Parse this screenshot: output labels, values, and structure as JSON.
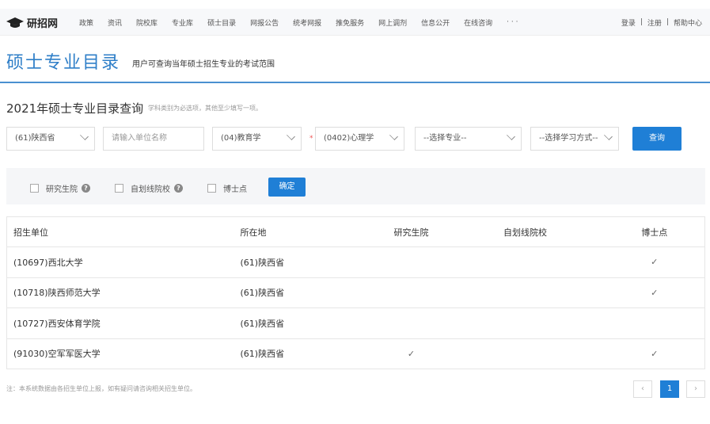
{
  "nav": {
    "logo": "研招网",
    "items": [
      "政策",
      "资讯",
      "院校库",
      "专业库",
      "硕士目录",
      "网报公告",
      "统考网报",
      "推免服务",
      "网上调剂",
      "信息公开",
      "在线咨询",
      "· · ·"
    ],
    "login": "登录",
    "sep": "|",
    "register": "注册",
    "help": "帮助中心"
  },
  "header": {
    "title": "硕士专业目录",
    "subtitle": "用户可查询当年硕士招生专业的考试范围"
  },
  "query": {
    "title": "2021年硕士专业目录查询",
    "hint": "学科类别为必选项，其他至少填写一项。",
    "province": "(61)陕西省",
    "unit_placeholder": "请输入单位名称",
    "category": "(04)教育学",
    "required_mark": "*",
    "discipline": "(0402)心理学",
    "major": "--选择专业--",
    "study_mode": "--选择学习方式--",
    "search": "查询"
  },
  "filters": {
    "graduate_school": "研究生院",
    "self_line": "自划线院校",
    "help_icon": "?",
    "doctoral": "博士点",
    "confirm": "确定"
  },
  "table": {
    "headers": [
      "招生单位",
      "所在地",
      "研究生院",
      "自划线院校",
      "博士点"
    ],
    "rows": [
      {
        "unit": "(10697)西北大学",
        "location": "(61)陕西省",
        "graduate_school": false,
        "self_line": false,
        "doctoral": true
      },
      {
        "unit": "(10718)陕西师范大学",
        "location": "(61)陕西省",
        "graduate_school": false,
        "self_line": false,
        "doctoral": true
      },
      {
        "unit": "(10727)西安体育学院",
        "location": "(61)陕西省",
        "graduate_school": false,
        "self_line": false,
        "doctoral": false
      },
      {
        "unit": "(91030)空军军医大学",
        "location": "(61)陕西省",
        "graduate_school": true,
        "self_line": false,
        "doctoral": true
      }
    ],
    "check": "✓"
  },
  "footnote": "注：本系统数据由各招生单位上报，如有疑问请咨询相关招生单位。",
  "pagination": {
    "prev": "‹",
    "current": "1",
    "next": "›"
  }
}
